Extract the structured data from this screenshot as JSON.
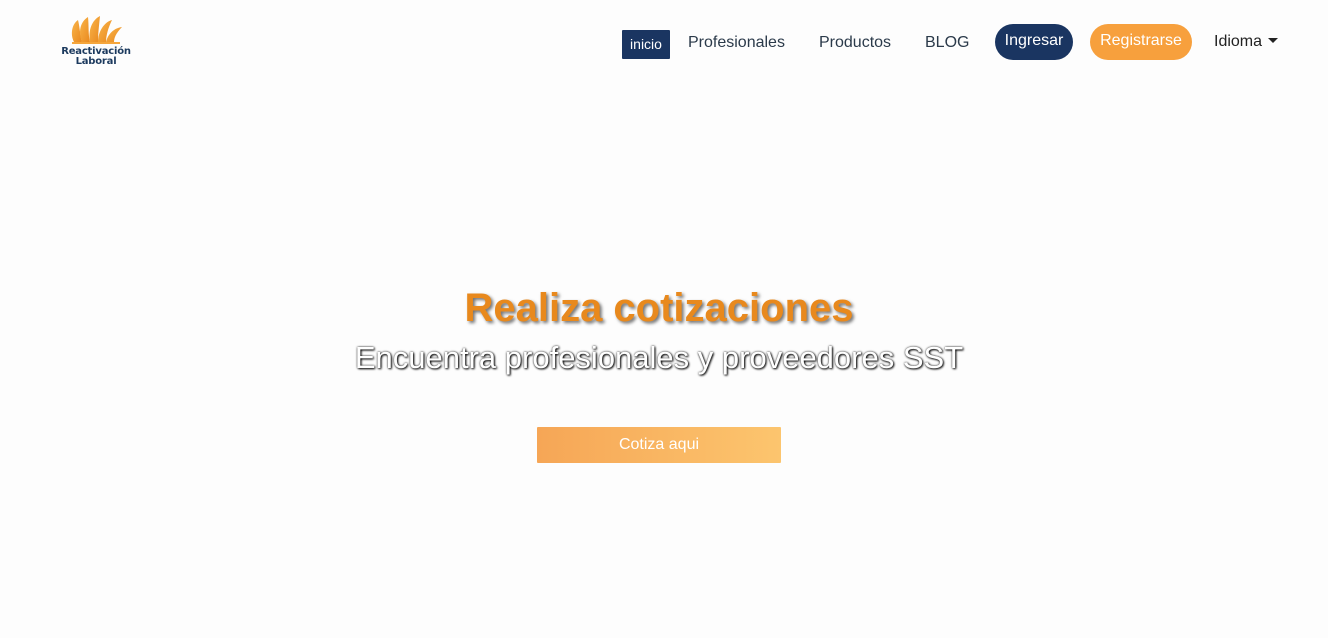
{
  "brand": {
    "line1": "Reactivación",
    "line2": "Laboral",
    "logo_icon": "sunburst-fan-icon",
    "colors": {
      "navy": "#1a3561",
      "orange": "#f7a03d"
    }
  },
  "nav": {
    "inicio": "inicio",
    "profesionales": "Profesionales",
    "productos": "Productos",
    "blog": "BLOG",
    "ingresar": "Ingresar",
    "registrarse": "Registrarse",
    "idioma": "Idioma"
  },
  "hero": {
    "title": "Realiza cotizaciones",
    "subtitle": "Encuentra profesionales y proveedores SST",
    "cta": "Cotiza aqui"
  }
}
